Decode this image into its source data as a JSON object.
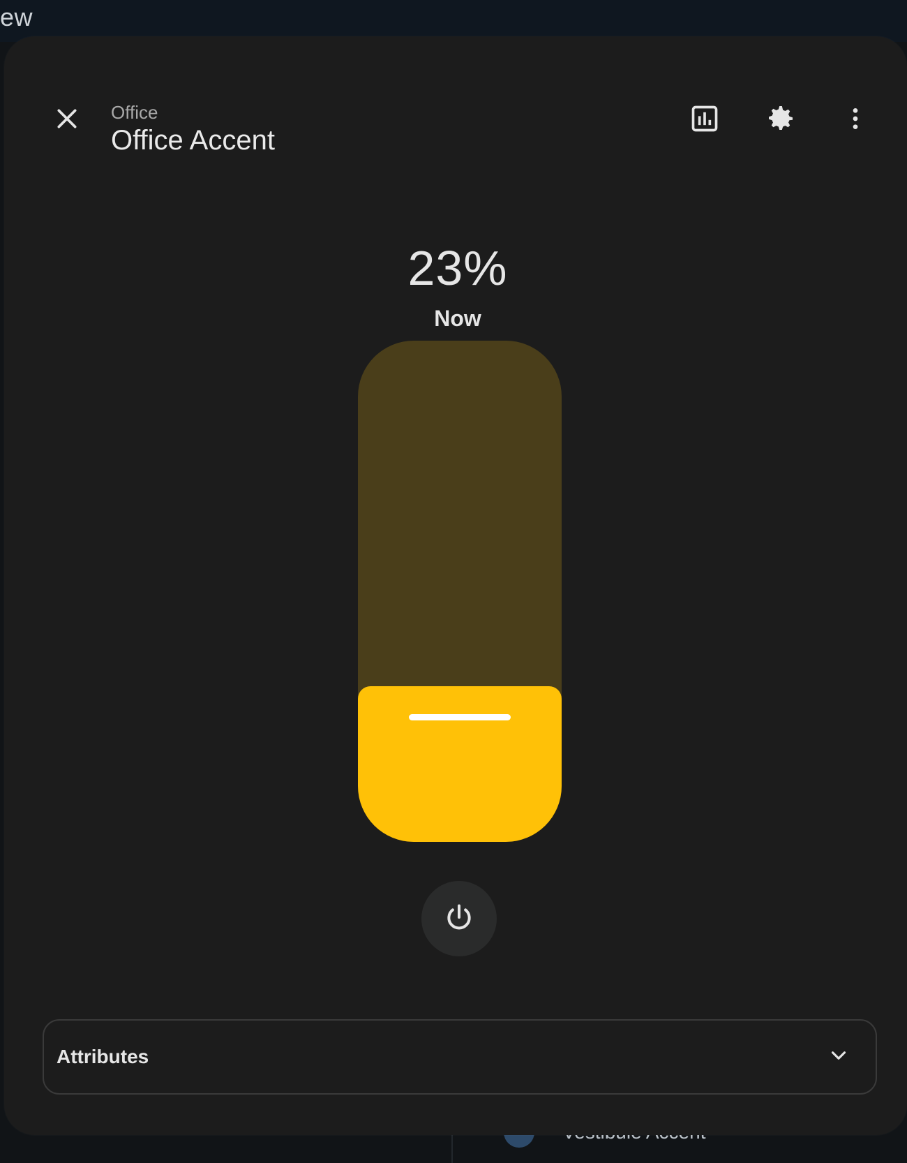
{
  "background": {
    "title": "ew",
    "bottom_item_label": "Vestibule Accent"
  },
  "header": {
    "subtitle": "Office",
    "title": "Office Accent",
    "close_icon": "close-icon",
    "history_icon": "chart-icon",
    "settings_icon": "gear-icon",
    "menu_icon": "more-vertical-icon"
  },
  "brightness": {
    "value": "23%",
    "label": "Now",
    "level": 0.23,
    "colors": {
      "track": "#4a3e1a",
      "fill": "#ffc107"
    }
  },
  "power_button": {
    "icon": "power-icon"
  },
  "attributes": {
    "label": "Attributes",
    "icon": "chevron-down-icon"
  }
}
